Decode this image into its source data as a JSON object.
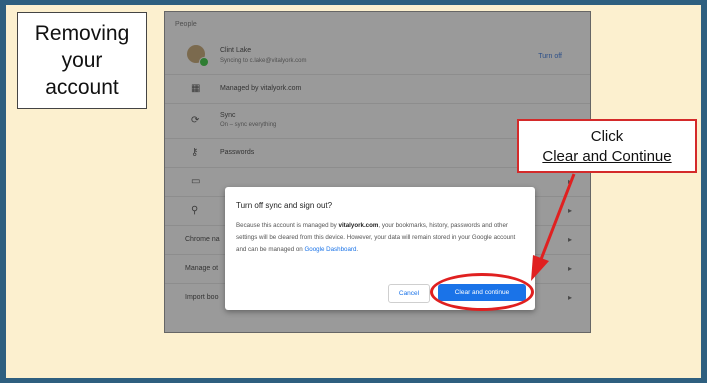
{
  "slide_title": {
    "line1": "Removing",
    "line2": "your",
    "line3": "account"
  },
  "settings": {
    "section_heading": "People",
    "account": {
      "name": "Clint Lake",
      "status": "Syncing to c.lake@vitalyork.com",
      "action": "Turn off"
    },
    "rows": [
      {
        "icon": "building-icon",
        "glyph": "▦",
        "label": "Managed by vitalyork.com"
      },
      {
        "icon": "sync-icon",
        "glyph": "⟳",
        "label": "Sync",
        "sub": "On – sync everything"
      },
      {
        "icon": "key-icon",
        "glyph": "⚷",
        "label": "Passwords"
      },
      {
        "icon": "card-icon",
        "glyph": "▭",
        "label": ""
      },
      {
        "icon": "location-icon",
        "glyph": "⚲",
        "label": ""
      }
    ],
    "short_rows": [
      "Chrome na",
      "Manage ot",
      "Import boo"
    ]
  },
  "dialog": {
    "title": "Turn off sync and sign out?",
    "body_prefix": "Because this account is managed by ",
    "body_domain": "vitalyork.com",
    "body_rest": ", your bookmarks, history, passwords and other settings will be cleared from this device. However, your data will remain stored in your Google account and can be managed on ",
    "body_link": "Google Dashboard",
    "body_end": ".",
    "cancel_label": "Cancel",
    "confirm_label": "Clear and continue"
  },
  "callout": {
    "line1": "Click",
    "line2": "Clear and Continue"
  },
  "colors": {
    "background": "#2e5f7f",
    "slide": "#fcf0cf",
    "accent_red": "#e02020",
    "button_blue": "#1a73e8"
  }
}
